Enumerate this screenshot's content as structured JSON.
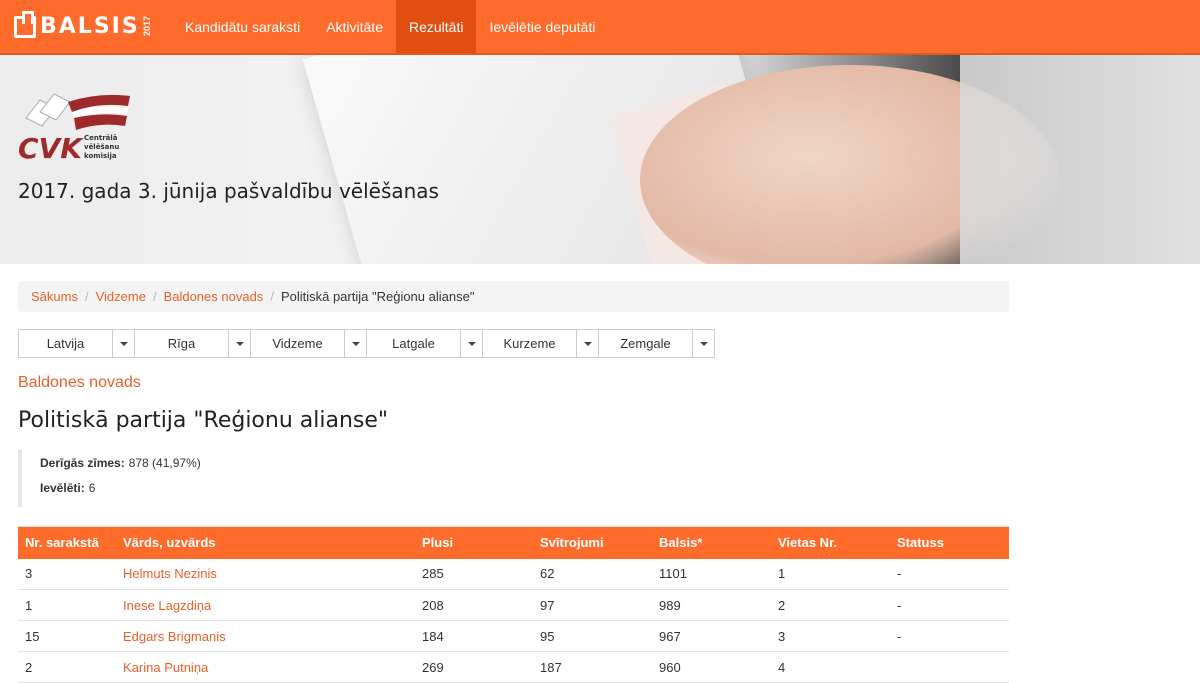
{
  "nav": {
    "brand": "BALSIS",
    "brand_year": "2017",
    "items": [
      {
        "label": "Kandidātu saraksti",
        "active": false
      },
      {
        "label": "Aktivitāte",
        "active": false
      },
      {
        "label": "Rezultāti",
        "active": true
      },
      {
        "label": "Ievēlētie deputāti",
        "active": false
      }
    ]
  },
  "hero": {
    "logo_text": "CVK",
    "logo_subtext": [
      "Centrālā",
      "vēlēšanu",
      "komisija"
    ],
    "title": "2017. gada 3. jūnija pašvaldību vēlēšanas"
  },
  "breadcrumb": {
    "links": [
      "Sākums",
      "Vidzeme",
      "Baldones novads"
    ],
    "current": "Politiskā partija \"Reģionu alianse\""
  },
  "regions": [
    "Latvija",
    "Rīga",
    "Vidzeme",
    "Latgale",
    "Kurzeme",
    "Zemgale"
  ],
  "district_link": "Baldones novads",
  "party_title": "Politiskā partija \"Reģionu alianse\"",
  "stats": {
    "valid_label": "Derīgās zīmes:",
    "valid_value": "878 (41,97%)",
    "elected_label": "Ievēlēti:",
    "elected_value": "6"
  },
  "table": {
    "headers": [
      "Nr. sarakstā",
      "Vārds, uzvārds",
      "Plusi",
      "Svītrojumi",
      "Balsis*",
      "Vietas Nr.",
      "Statuss"
    ],
    "rows": [
      [
        "3",
        "Helmuts Nezinis",
        "285",
        "62",
        "1101",
        "1",
        "-"
      ],
      [
        "1",
        "Inese Lagzdiņa",
        "208",
        "97",
        "989",
        "2",
        "-"
      ],
      [
        "15",
        "Edgars Brigmanis",
        "184",
        "95",
        "967",
        "3",
        "-"
      ],
      [
        "2",
        "Karina Putniņa",
        "269",
        "187",
        "960",
        "4",
        ""
      ]
    ]
  },
  "colors": {
    "accent": "#ff6b2b",
    "accent_dark": "#e04e10",
    "link": "#e8602a"
  }
}
